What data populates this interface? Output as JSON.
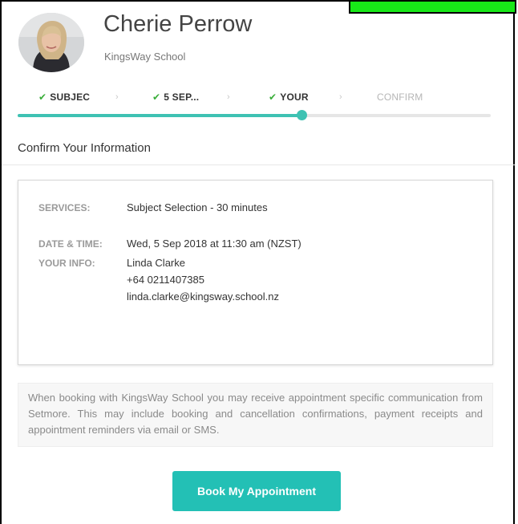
{
  "profile": {
    "name": "Cherie Perrow",
    "school": "KingsWay School"
  },
  "steps": [
    {
      "label": "SUBJEC",
      "done": true
    },
    {
      "label": "5 SEP...",
      "done": true
    },
    {
      "label": "YOUR",
      "done": true
    },
    {
      "label": "CONFIRM",
      "done": false
    }
  ],
  "progress": {
    "fraction": 0.6
  },
  "section": {
    "title": "Confirm Your Information"
  },
  "details": {
    "services_label": "SERVICES:",
    "services_value": "Subject Selection - 30 minutes",
    "datetime_label": "DATE & TIME:",
    "datetime_value": "Wed, 5 Sep 2018 at 11:30 am (NZST)",
    "info_label": "YOUR INFO:",
    "info_name": "Linda Clarke",
    "info_phone": "+64 0211407385",
    "info_email": "linda.clarke@kingsway.school.nz"
  },
  "notice": {
    "text": "When booking with KingsWay School you may receive appointment specific communication from Setmore. This may include booking and cancellation confirmations, payment receipts and appointment reminders via email or SMS."
  },
  "actions": {
    "book_label": "Book My Appointment"
  },
  "colors": {
    "accent": "#23c0b5",
    "check": "#3aae3a"
  }
}
